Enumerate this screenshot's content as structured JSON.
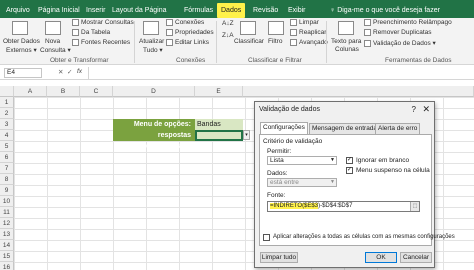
{
  "ribbon_tabs": [
    "Arquivo",
    "Página Inicial",
    "Inserir",
    "Layout da Página",
    "Fórmulas",
    "Dados",
    "Revisão",
    "Exibir"
  ],
  "tell_me": "♀ Diga-me o que você deseja fazer",
  "ribbon": {
    "obter": {
      "label1": "Obter Dados",
      "label2": "Externos ▾"
    },
    "mostrar_consultas": "Mostrar Consultas",
    "da_tabela": "Da Tabela",
    "fontes_recentes": "Fontes Recentes",
    "nova_consulta": "Nova",
    "consulta": "Consulta ▾",
    "atualizar": "Atualizar",
    "tudo": "Tudo ▾",
    "conexoes": "Conexões",
    "propriedades": "Propriedades",
    "editar_links": "Editar Links",
    "classificar_az": "A↓Z",
    "classificar_za": "Z↓A",
    "classificar": "Classificar",
    "filtro": "Filtro",
    "limpar": "Limpar",
    "reaplicar": "Reaplicar",
    "avancado": "Avançado",
    "texto_colunas1": "Texto para",
    "texto_colunas2": "Colunas",
    "preenchimento": "Preenchimento Relâmpago",
    "remover_duplicatas": "Remover Duplicatas",
    "validacao": "Validação de Dados ▾",
    "groups": [
      "Obter e Transformar",
      "Conexões",
      "Classificar e Filtrar",
      "Ferramentas de Dados"
    ]
  },
  "formula_bar": {
    "name_box": "E4",
    "fx": "fx"
  },
  "columns": [
    "A",
    "B",
    "C",
    "D",
    "E"
  ],
  "rows": [
    "1",
    "2",
    "3",
    "4",
    "5",
    "6",
    "7",
    "8",
    "9",
    "10",
    "11",
    "12",
    "13",
    "14",
    "15",
    "16"
  ],
  "cells": {
    "menu_label": "Menu de opções:",
    "menu_value": "Bandas",
    "cond_label": "respostas condicionais:"
  },
  "dialog": {
    "title": "Validação de dados",
    "help": "?",
    "close": "✕",
    "tabs": [
      "Configurações",
      "Mensagem de entrada",
      "Alerta de erro"
    ],
    "criterio": "Critério de validação",
    "permitir_label": "Permitir:",
    "permitir_value": "Lista",
    "ignorar_branco": "Ignorar em branco",
    "menu_suspenso": "Menu suspenso na célula",
    "dados_label": "Dados:",
    "dados_value": "está entre",
    "fonte_label": "Fonte:",
    "fonte_formula": "=INDIRETO($E$3",
    "fonte_rest": ")-$D$4:$D$7",
    "aplicar": "Aplicar alterações a todas as células com as mesmas configurações",
    "limpar_tudo": "Limpar tudo",
    "ok": "OK",
    "cancelar": "Cancelar"
  }
}
